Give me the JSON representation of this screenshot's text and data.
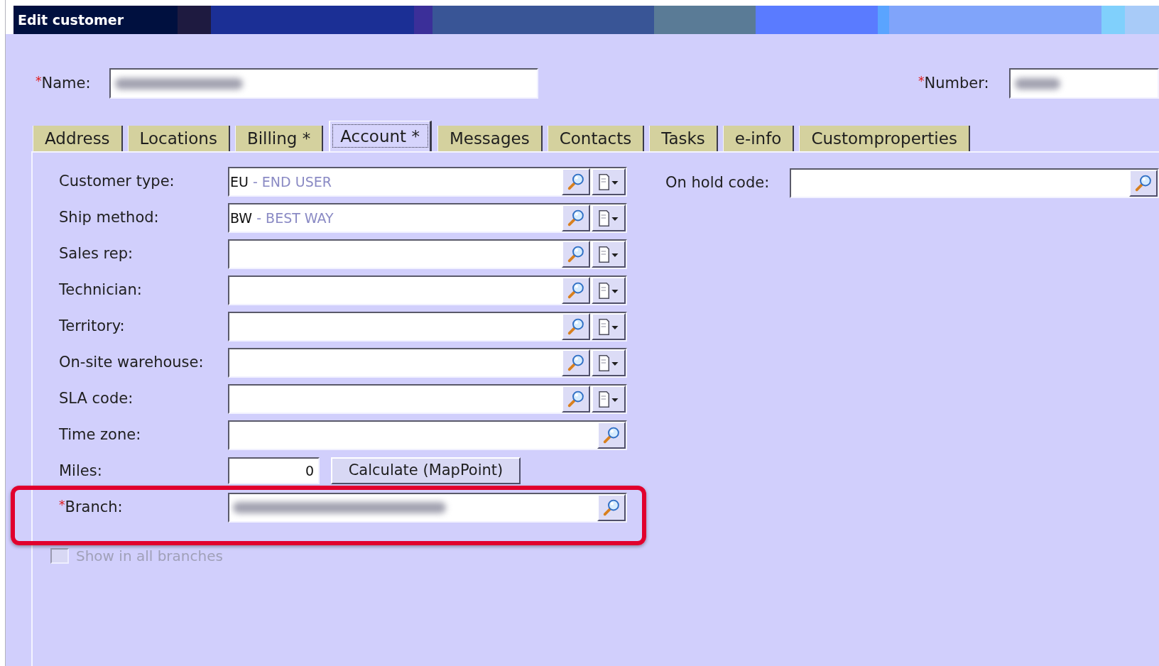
{
  "window": {
    "title": "Edit customer"
  },
  "header_fields": [
    {
      "label": "Name:",
      "required_mark": "*",
      "redacted": true
    },
    {
      "label": "Number:",
      "required_mark": "*",
      "redacted": true
    }
  ],
  "tabs": [
    {
      "label": "Address",
      "selected": false
    },
    {
      "label": "Locations",
      "selected": false
    },
    {
      "label": "Billing *",
      "selected": false
    },
    {
      "label": "Account *",
      "selected": true
    },
    {
      "label": "Messages",
      "selected": false
    },
    {
      "label": "Contacts",
      "selected": false
    },
    {
      "label": "Tasks",
      "selected": false
    },
    {
      "label": "e-info",
      "selected": false
    },
    {
      "label": "Customproperties",
      "selected": false
    }
  ],
  "account_panel": {
    "fields": [
      {
        "kind": "lookup_menu",
        "label": "Customer type:",
        "value": "EU",
        "value_detail": "- END USER"
      },
      {
        "kind": "lookup_menu",
        "label": "Ship method:",
        "value": "BW",
        "value_detail": "- BEST WAY"
      },
      {
        "kind": "lookup_menu",
        "label": "Sales rep:"
      },
      {
        "kind": "lookup_menu",
        "label": "Technician:"
      },
      {
        "kind": "lookup_menu",
        "label": "Territory:"
      },
      {
        "kind": "lookup_menu",
        "label": "On-site warehouse:"
      },
      {
        "kind": "lookup_menu",
        "label": "SLA code:"
      },
      {
        "kind": "lookup",
        "label": "Time zone:"
      },
      {
        "kind": "number",
        "label": "Miles:",
        "value": "0",
        "button": "Calculate (MapPoint)"
      },
      {
        "kind": "lookup",
        "label": "Branch:",
        "required_mark": "*",
        "redacted": true,
        "highlighted": true
      }
    ],
    "checkbox": {
      "label": "Show in all branches",
      "checked": false,
      "disabled": true
    },
    "side_fields": [
      {
        "kind": "lookup",
        "label": "On hold code:"
      }
    ]
  }
}
